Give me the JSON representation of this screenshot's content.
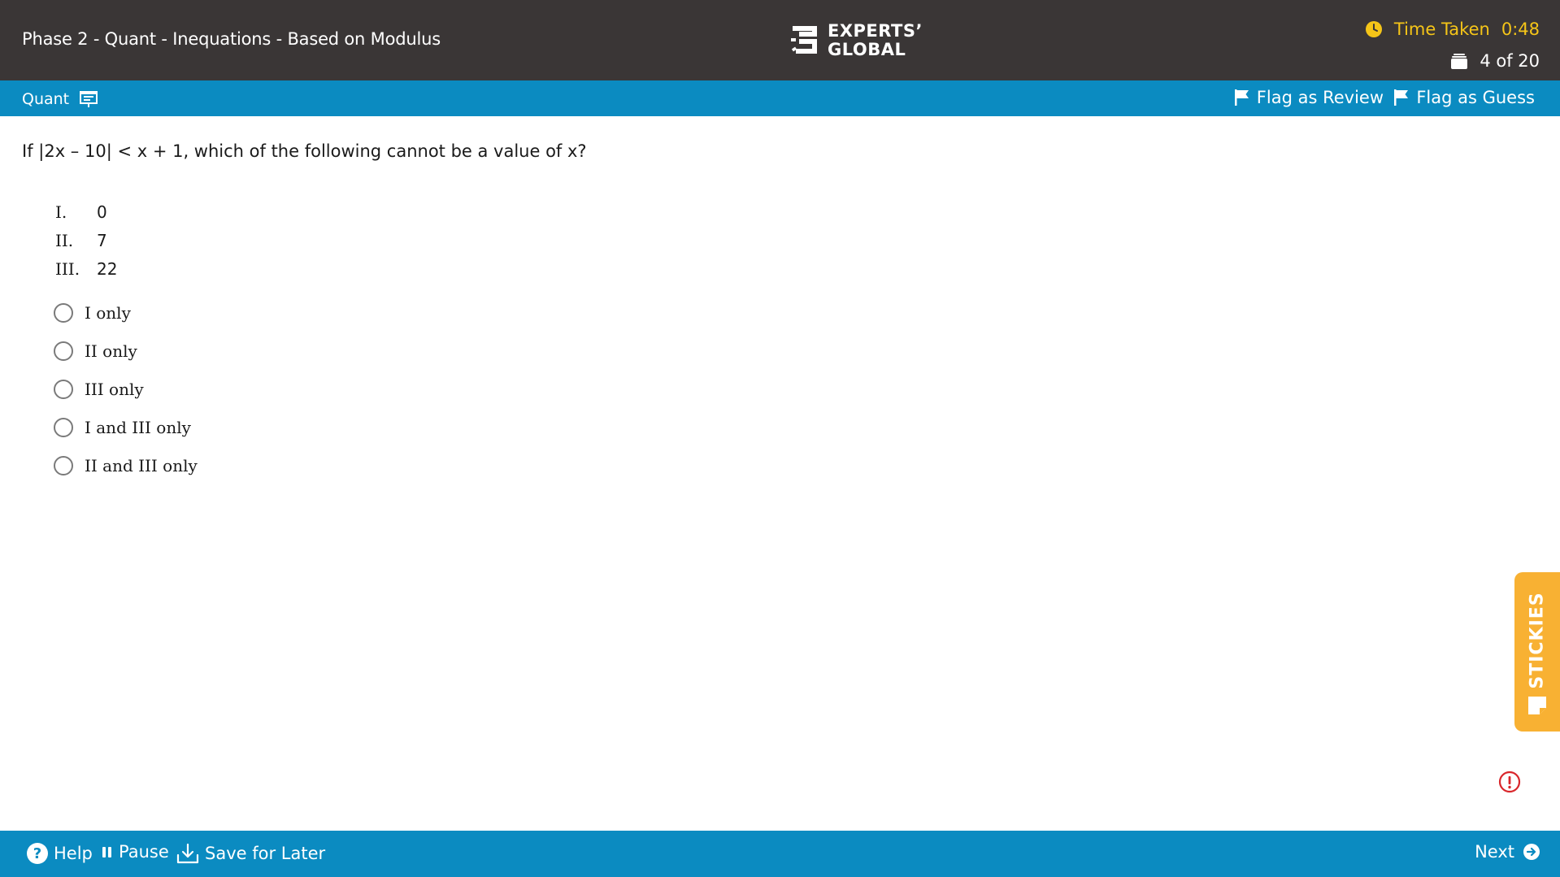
{
  "header": {
    "test_title": "Phase 2 - Quant - Inequations - Based on Modulus",
    "logo_line1": "EXPERTS’",
    "logo_line2": "GLOBAL",
    "timer_label": "Time Taken",
    "timer_value": "0:48",
    "progress": "4 of 20",
    "timer_color": "#f5c518"
  },
  "section_bar": {
    "section_name": "Quant",
    "section_icon": "presentation-board-icon",
    "flag_review_label": "Flag as Review",
    "flag_guess_label": "Flag as Guess"
  },
  "question": {
    "stem": "If |2x – 10| < x + 1, which of the following cannot be a value of x?",
    "statements": [
      {
        "num": "I.",
        "value": "0"
      },
      {
        "num": "II.",
        "value": "7"
      },
      {
        "num": "III.",
        "value": "22"
      }
    ],
    "options": [
      {
        "label": "I only",
        "selected": false
      },
      {
        "label": "II only",
        "selected": false
      },
      {
        "label": "III only",
        "selected": false
      },
      {
        "label": "I and III only",
        "selected": false
      },
      {
        "label": "II and III only",
        "selected": false
      }
    ]
  },
  "stickies": {
    "label": "STICKIES",
    "color": "#f8b133"
  },
  "footer": {
    "help_label": "Help",
    "pause_label": "Pause",
    "save_label": "Save for Later",
    "next_label": "Next"
  },
  "colors": {
    "header_bg": "#3a3636",
    "accent_blue": "#0b8bc1",
    "report_red": "#d9262b"
  }
}
